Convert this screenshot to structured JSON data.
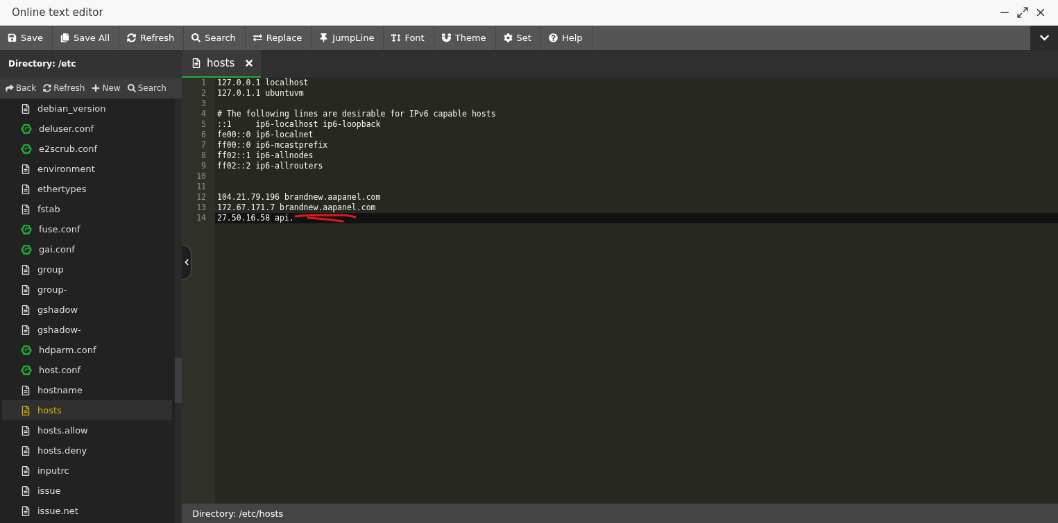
{
  "window": {
    "title": "Online text editor"
  },
  "toolbar": [
    {
      "kind": "save",
      "label": "Save"
    },
    {
      "kind": "saveall",
      "label": "Save All"
    },
    {
      "kind": "refresh",
      "label": "Refresh"
    },
    {
      "kind": "search",
      "label": "Search"
    },
    {
      "kind": "replace",
      "label": "Replace"
    },
    {
      "kind": "jump",
      "label": "JumpLine"
    },
    {
      "kind": "font",
      "label": "Font"
    },
    {
      "kind": "theme",
      "label": "Theme"
    },
    {
      "kind": "set",
      "label": "Set"
    },
    {
      "kind": "help",
      "label": "Help"
    }
  ],
  "sidebar": {
    "directory": "Directory: /etc",
    "actions": [
      {
        "kind": "back",
        "label": "Back"
      },
      {
        "kind": "refresh",
        "label": "Refresh"
      },
      {
        "kind": "new",
        "label": "New"
      },
      {
        "kind": "search",
        "label": "Search"
      }
    ],
    "items": [
      {
        "kind": "text",
        "name": "debian_version",
        "selected": false
      },
      {
        "kind": "config",
        "name": "deluser.conf",
        "selected": false
      },
      {
        "kind": "config",
        "name": "e2scrub.conf",
        "selected": false
      },
      {
        "kind": "text",
        "name": "environment",
        "selected": false
      },
      {
        "kind": "text",
        "name": "ethertypes",
        "selected": false
      },
      {
        "kind": "text",
        "name": "fstab",
        "selected": false
      },
      {
        "kind": "config",
        "name": "fuse.conf",
        "selected": false
      },
      {
        "kind": "config",
        "name": "gai.conf",
        "selected": false
      },
      {
        "kind": "text",
        "name": "group",
        "selected": false
      },
      {
        "kind": "text",
        "name": "group-",
        "selected": false
      },
      {
        "kind": "text",
        "name": "gshadow",
        "selected": false
      },
      {
        "kind": "text",
        "name": "gshadow-",
        "selected": false
      },
      {
        "kind": "config",
        "name": "hdparm.conf",
        "selected": false
      },
      {
        "kind": "config",
        "name": "host.conf",
        "selected": false
      },
      {
        "kind": "text",
        "name": "hostname",
        "selected": false
      },
      {
        "kind": "text",
        "name": "hosts",
        "selected": true
      },
      {
        "kind": "text",
        "name": "hosts.allow",
        "selected": false
      },
      {
        "kind": "text",
        "name": "hosts.deny",
        "selected": false
      },
      {
        "kind": "text",
        "name": "inputrc",
        "selected": false
      },
      {
        "kind": "text",
        "name": "issue",
        "selected": false
      },
      {
        "kind": "text",
        "name": "issue.net",
        "selected": false
      }
    ]
  },
  "tabs": [
    {
      "label": "hosts",
      "selected": true
    }
  ],
  "editor": {
    "lines": [
      {
        "number": "1",
        "text": "127.0.0.1 localhost",
        "current": false
      },
      {
        "number": "2",
        "text": "127.0.1.1 ubuntuvm",
        "current": false
      },
      {
        "number": "3",
        "current": false
      },
      {
        "number": "4",
        "text": "# The following lines are desirable for IPv6 capable hosts",
        "current": false
      },
      {
        "number": "5",
        "text": "::1     ip6-localhost ip6-loopback",
        "current": false
      },
      {
        "number": "6",
        "text": "fe00::0 ip6-localnet",
        "current": false
      },
      {
        "number": "7",
        "text": "ff00::0 ip6-mcastprefix",
        "current": false
      },
      {
        "number": "8",
        "text": "ff02::1 ip6-allnodes",
        "current": false
      },
      {
        "number": "9",
        "text": "ff02::2 ip6-allrouters",
        "current": false
      },
      {
        "number": "10",
        "current": false
      },
      {
        "number": "11",
        "current": false
      },
      {
        "number": "12",
        "text": "104.21.79.196 brandnew.aapanel.com",
        "current": false
      },
      {
        "number": "13",
        "text": "172.67.171.7 brandnew.aapanel.com",
        "current": false
      },
      {
        "number": "14",
        "text": "27.50.16.58 api.",
        "current": true,
        "redacted": true
      }
    ]
  },
  "status_bar": {
    "path": "Directory: /etc/hosts"
  }
}
